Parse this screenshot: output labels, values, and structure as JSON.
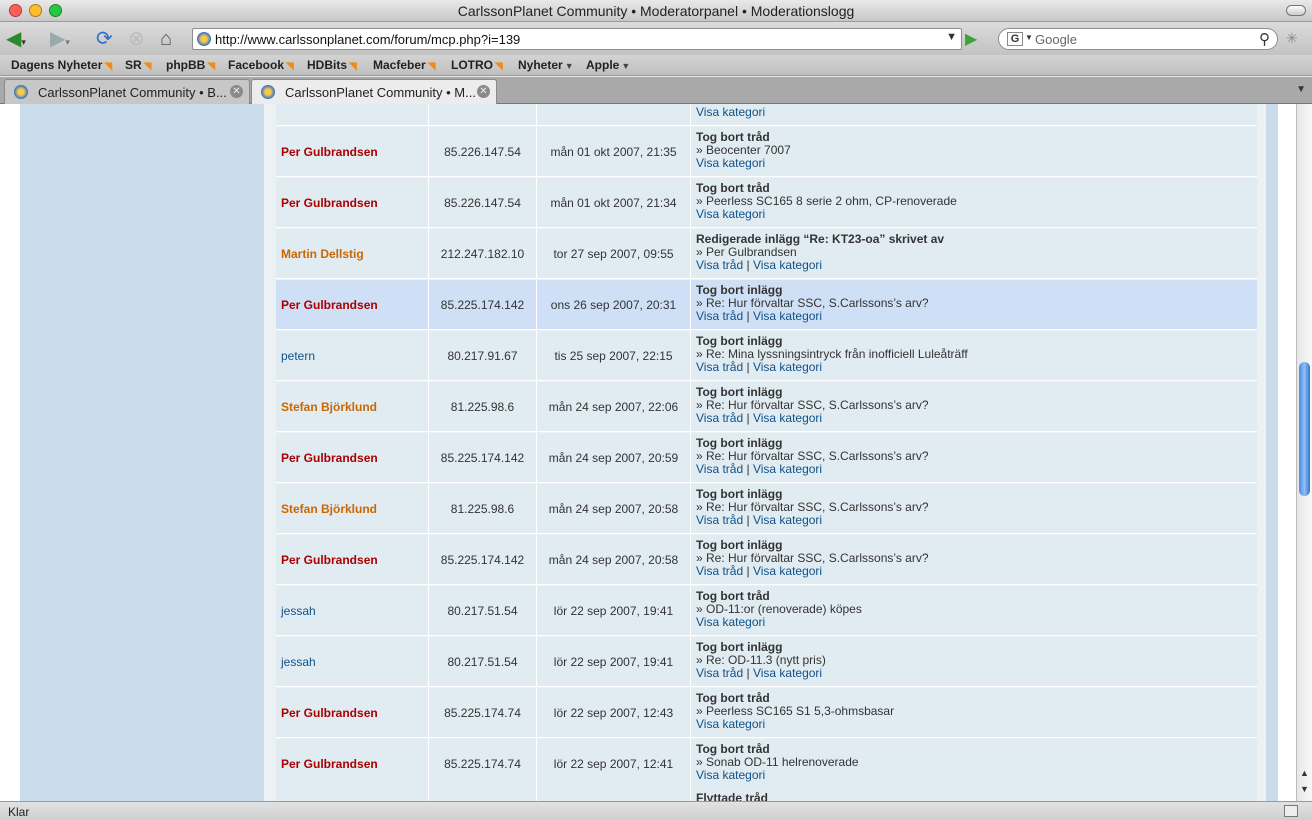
{
  "window": {
    "title": "CarlssonPlanet Community • Moderatorpanel • Moderationslogg"
  },
  "toolbar": {
    "url": "http://www.carlssonplanet.com/forum/mcp.php?i=139",
    "search_placeholder": "Google",
    "search_engine_letter": "G"
  },
  "bookmarks": [
    {
      "label": "Dagens Nyheter",
      "feed": true,
      "menu": false
    },
    {
      "label": "SR",
      "feed": true,
      "menu": false
    },
    {
      "label": "phpBB",
      "feed": true,
      "menu": false
    },
    {
      "label": "Facebook",
      "feed": true,
      "menu": false
    },
    {
      "label": "HDBits",
      "feed": true,
      "menu": false
    },
    {
      "label": "Macfeber",
      "feed": true,
      "menu": false
    },
    {
      "label": "LOTRO",
      "feed": true,
      "menu": false
    },
    {
      "label": "Nyheter",
      "feed": false,
      "menu": true
    },
    {
      "label": "Apple",
      "feed": false,
      "menu": true
    }
  ],
  "tabs": [
    {
      "label": "CarlssonPlanet Community • B...",
      "active": false
    },
    {
      "label": "CarlssonPlanet Community • M...",
      "active": true
    }
  ],
  "partial_top_row": {
    "link": "Visa kategori"
  },
  "log_rows": [
    {
      "user": "Per Gulbrandsen",
      "color": "red",
      "ip": "85.226.147.54",
      "time": "mån 01 okt 2007, 21:35",
      "action": "Tog bort tråd",
      "detail": "» Beocenter 7007",
      "links": [
        "Visa kategori"
      ]
    },
    {
      "user": "Per Gulbrandsen",
      "color": "red",
      "ip": "85.226.147.54",
      "time": "mån 01 okt 2007, 21:34",
      "action": "Tog bort tråd",
      "detail": "» Peerless SC165 8 serie 2 ohm, CP-renoverade",
      "links": [
        "Visa kategori"
      ]
    },
    {
      "user": "Martin Dellstig",
      "color": "orange",
      "ip": "212.247.182.10",
      "time": "tor 27 sep 2007, 09:55",
      "action": "Redigerade inlägg “Re: KT23-oa” skrivet av",
      "detail": "» Per Gulbrandsen",
      "links": [
        "Visa tråd",
        "Visa kategori"
      ]
    },
    {
      "user": "Per Gulbrandsen",
      "color": "red",
      "ip": "85.225.174.142",
      "time": "ons 26 sep 2007, 20:31",
      "action": "Tog bort inlägg",
      "detail": "» Re: Hur förvaltar SSC, S.Carlssons’s arv?",
      "links": [
        "Visa tråd",
        "Visa kategori"
      ],
      "highlight": true
    },
    {
      "user": "petern",
      "color": "blue",
      "ip": "80.217.91.67",
      "time": "tis 25 sep 2007, 22:15",
      "action": "Tog bort inlägg",
      "detail": "» Re: Mina lyssningsintryck från inofficiell Luleåträff",
      "links": [
        "Visa tråd",
        "Visa kategori"
      ]
    },
    {
      "user": "Stefan Björklund",
      "color": "orange",
      "ip": "81.225.98.6",
      "time": "mån 24 sep 2007, 22:06",
      "action": "Tog bort inlägg",
      "detail": "» Re: Hur förvaltar SSC, S.Carlssons’s arv?",
      "links": [
        "Visa tråd",
        "Visa kategori"
      ]
    },
    {
      "user": "Per Gulbrandsen",
      "color": "red",
      "ip": "85.225.174.142",
      "time": "mån 24 sep 2007, 20:59",
      "action": "Tog bort inlägg",
      "detail": "» Re: Hur förvaltar SSC, S.Carlssons’s arv?",
      "links": [
        "Visa tråd",
        "Visa kategori"
      ]
    },
    {
      "user": "Stefan Björklund",
      "color": "orange",
      "ip": "81.225.98.6",
      "time": "mån 24 sep 2007, 20:58",
      "action": "Tog bort inlägg",
      "detail": "» Re: Hur förvaltar SSC, S.Carlssons’s arv?",
      "links": [
        "Visa tråd",
        "Visa kategori"
      ]
    },
    {
      "user": "Per Gulbrandsen",
      "color": "red",
      "ip": "85.225.174.142",
      "time": "mån 24 sep 2007, 20:58",
      "action": "Tog bort inlägg",
      "detail": "» Re: Hur förvaltar SSC, S.Carlssons’s arv?",
      "links": [
        "Visa tråd",
        "Visa kategori"
      ]
    },
    {
      "user": "jessah",
      "color": "blue",
      "ip": "80.217.51.54",
      "time": "lör 22 sep 2007, 19:41",
      "action": "Tog bort tråd",
      "detail": "» OD-11:or (renoverade) köpes",
      "links": [
        "Visa kategori"
      ]
    },
    {
      "user": "jessah",
      "color": "blue",
      "ip": "80.217.51.54",
      "time": "lör 22 sep 2007, 19:41",
      "action": "Tog bort inlägg",
      "detail": "» Re: OD-11.3 (nytt pris)",
      "links": [
        "Visa tråd",
        "Visa kategori"
      ]
    },
    {
      "user": "Per Gulbrandsen",
      "color": "red",
      "ip": "85.225.174.74",
      "time": "lör 22 sep 2007, 12:43",
      "action": "Tog bort tråd",
      "detail": "» Peerless SC165 S1 5,3-ohmsbasar",
      "links": [
        "Visa kategori"
      ]
    },
    {
      "user": "Per Gulbrandsen",
      "color": "red",
      "ip": "85.225.174.74",
      "time": "lör 22 sep 2007, 12:41",
      "action": "Tog bort tråd",
      "detail": "» Sonab OD-11 helrenoverade",
      "links": [
        "Visa kategori"
      ]
    }
  ],
  "partial_bottom_row": {
    "action": "Flyttade tråd"
  },
  "statusbar": {
    "text": "Klar"
  },
  "colors": {
    "red": "#aa0000",
    "orange": "#cc6600",
    "blue": "#105289",
    "row_bg": "#e1ebf2",
    "row_highlight": "#cfe0f6",
    "sidebar": "#cadceb"
  }
}
